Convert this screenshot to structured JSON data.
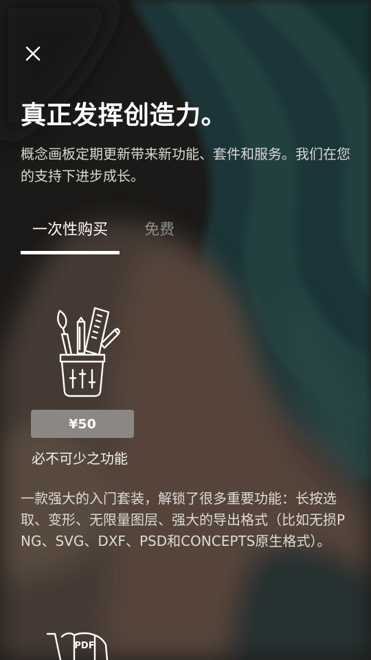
{
  "close": {
    "icon": "close-icon"
  },
  "header": {
    "title": "真正发挥创造力。",
    "description": "概念画板定期更新带来新功能、套件和服务。我们在您的支持下进步成长。"
  },
  "tabs": [
    {
      "label": "一次性购买",
      "active": true
    },
    {
      "label": "免费",
      "active": false
    }
  ],
  "product": {
    "icon": "tool-cup-icon",
    "price": "¥50",
    "name": "必不可少之功能",
    "description": "一款强大的入门套装，解锁了很多重要功能：长按选取、变形、无限量图层、强大的导出格式（比如无损PNG、SVG、DXF、PSD和CONCEPTS原生格式）。"
  },
  "next_product": {
    "icon": "pdf-cart-icon",
    "icon_text": "PDF"
  },
  "colors": {
    "background": "#1b1a18",
    "teal": "#17393a",
    "brown": "#5e4a3e",
    "price_button": "#8a8784",
    "inactive_tab": "#8d8d8a"
  }
}
